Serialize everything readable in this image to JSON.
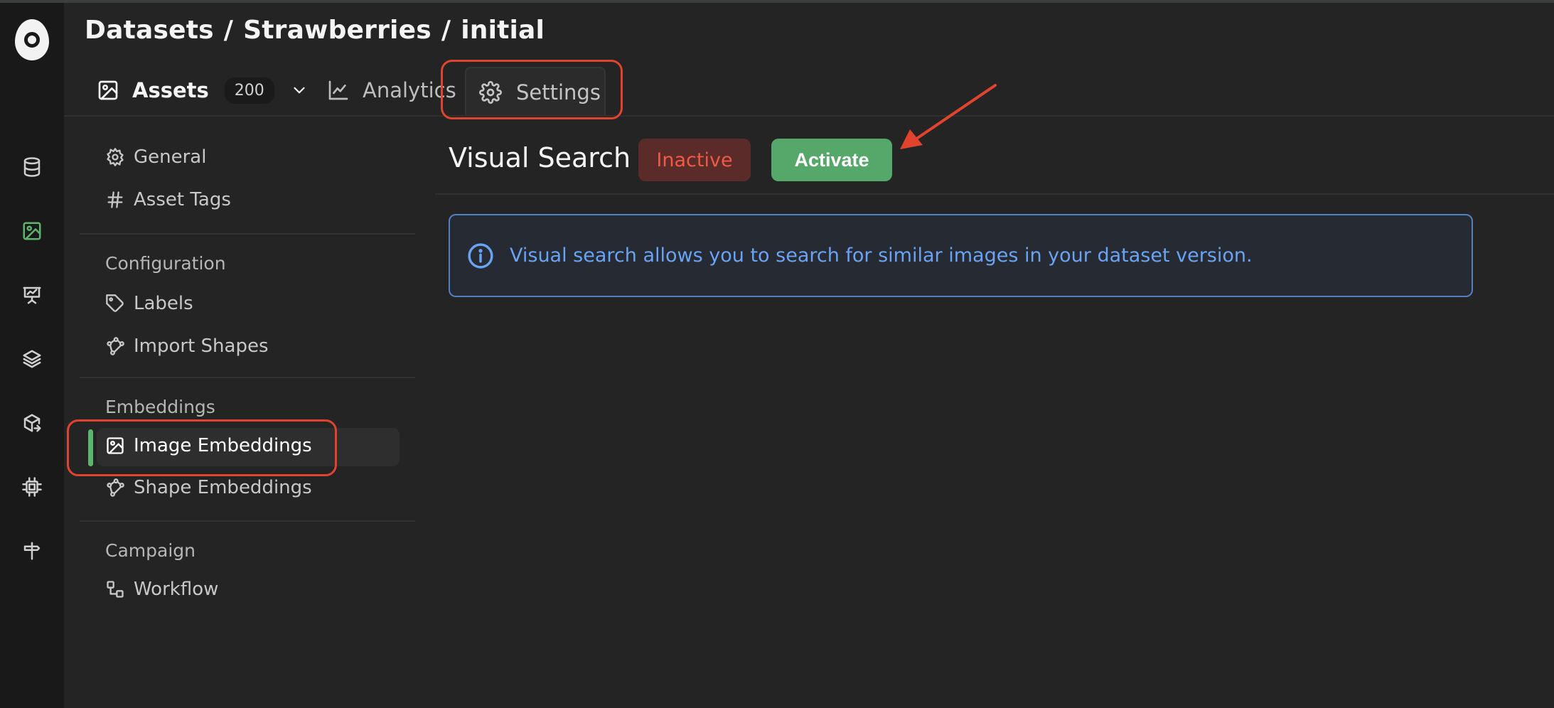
{
  "breadcrumb": {
    "part1": "Datasets",
    "part2": "Strawberries",
    "part3": "initial",
    "separator": "/"
  },
  "tabs": {
    "assets_label": "Assets",
    "assets_count": "200",
    "analytics_label": "Analytics",
    "settings_label": "Settings"
  },
  "nav": {
    "general": "General",
    "asset_tags": "Asset Tags",
    "configuration_section": "Configuration",
    "labels": "Labels",
    "import_shapes": "Import Shapes",
    "embeddings_section": "Embeddings",
    "image_embeddings": "Image Embeddings",
    "shape_embeddings": "Shape Embeddings",
    "campaign_section": "Campaign",
    "workflow": "Workflow"
  },
  "main": {
    "title": "Visual Search",
    "status": "Inactive",
    "activate_label": "Activate",
    "info_text": "Visual search allows you to search for similar images in your dataset version."
  },
  "colors": {
    "accent_green": "#5cb56f",
    "inactive_red": "#ef5a48",
    "info_blue": "#6aa3f3",
    "annotation_red": "#e0442f"
  },
  "rail_icons": [
    "database-icon",
    "image-icon",
    "presentation-chart-icon",
    "layers-icon",
    "box-arrow-icon",
    "chip-icon",
    "signpost-icon"
  ]
}
